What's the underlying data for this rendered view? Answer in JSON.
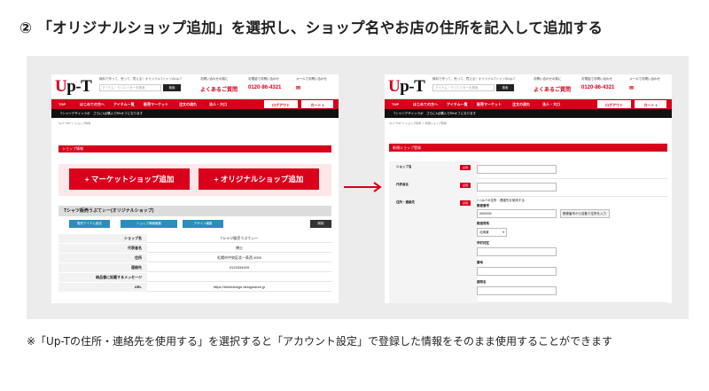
{
  "heading": "② 「オリジナルショップ追加」を選択し、ショップ名やお店の住所を記入して追加する",
  "note": "※「Up-Tの住所・連絡先を使用する」を選択すると「アカウント設定」で登録した情報をそのまま使用することができます",
  "site": {
    "logo_mark": "U",
    "logo_rest": "p-T",
    "tagline": "無料で作って、売って、買える！オリジナルTシャツのUp-T",
    "search_placeholder": "アイテム・クリエイターを検索",
    "search_button": "検索",
    "contact1_label": "お問い合わせの前に",
    "contact1_value": "よくあるご質問",
    "contact2_label": "お電話でお問い合わせ",
    "contact2_value": "0120-86-4321",
    "contact3_label": "メールでお問い合わせ",
    "nav": [
      "TOP",
      "はじめての方へ",
      "アイテム一覧",
      "販売マーケット",
      "注文の流れ",
      "法人・大口"
    ],
    "logout": "ログアウト",
    "cart": "カート 1",
    "promo_label": "Tシャツデザインラボ",
    "promo_text": "さらに4点購入で5%オフになります"
  },
  "left": {
    "breadcrumb": "Up-T TOP ＞ ショップ情報",
    "bar": "ショップ情報",
    "market_button": "+ マーケットショップ追加",
    "original_button": "+ オリジナルショップ追加",
    "shop_header": "Tシャツ販売うぶてぃー(オリジナルショップ)",
    "btn_items": "販売アイテム設定",
    "btn_info": "ショップ情報編集",
    "btn_design": "デザイン編集",
    "btn_delete": "削除",
    "rows": [
      {
        "k": "ショップ名",
        "v": "Tシャツ販売うぶてぃー"
      },
      {
        "k": "代表者名",
        "v": "博士"
      },
      {
        "k": "住所",
        "v": "札幌市中央区北一条西 0000"
      },
      {
        "k": "連絡先",
        "v": "0123334009"
      },
      {
        "k": "納品書に記載するメッセージ",
        "v": ""
      },
      {
        "k": "URL",
        "v": "https://tshirtdesign.designstore.jp"
      }
    ]
  },
  "right": {
    "breadcrumb": "Up-T TOP ＞ ショップ情報 ＞ 新規ショップ登録",
    "bar": "新規ショップ登録",
    "required": "必須",
    "f_shop": "ショップ名",
    "f_rep": "代表者名",
    "f_addr": "住所・連絡先",
    "use_upt": "Up-Tの住所・連絡先を使用する",
    "zip_label": "郵便番号",
    "zip_value": "0600005",
    "zip_button": "郵便番号から自動で住所を入力",
    "pref_label": "都道府県",
    "pref_value": "北海道",
    "city_label": "市町村区",
    "street_label": "番地",
    "bldg_label": "建物名"
  },
  "colors": {
    "brand_red": "#d9001b",
    "button_blue": "#2d8cbe"
  }
}
